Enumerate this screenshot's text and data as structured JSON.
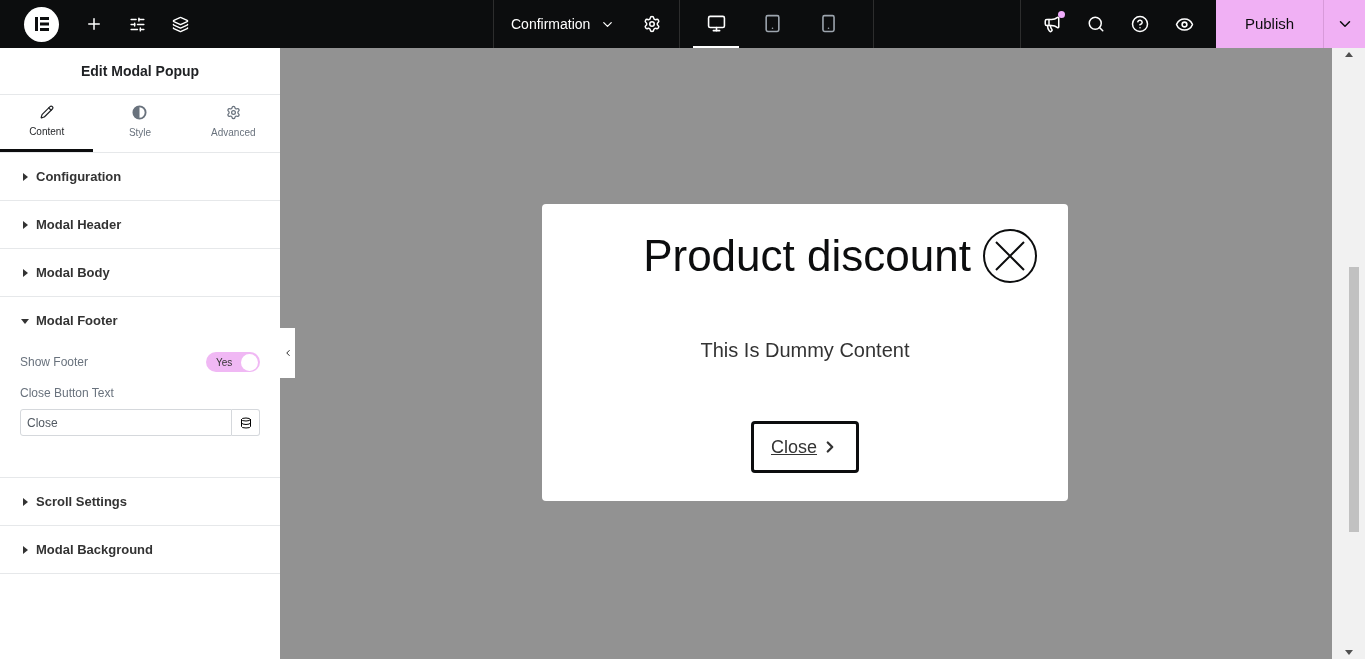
{
  "topbar": {
    "document_title": "Confirmation",
    "devices": [
      {
        "kind": "desktop",
        "selected": true
      },
      {
        "kind": "tablet",
        "selected": false
      },
      {
        "kind": "mobile",
        "selected": false
      }
    ],
    "notification": true,
    "publish": "Publish"
  },
  "panel": {
    "title": "Edit Modal Popup",
    "tabs": [
      {
        "kind": "content",
        "label": "Content",
        "selected": true
      },
      {
        "kind": "style",
        "label": "Style",
        "selected": false
      },
      {
        "kind": "advanced",
        "label": "Advanced",
        "selected": false
      }
    ],
    "sections": [
      {
        "title": "Configuration",
        "expanded": false
      },
      {
        "title": "Modal Header",
        "expanded": false
      },
      {
        "title": "Modal Body",
        "expanded": false
      },
      {
        "title": "Modal Footer",
        "expanded": true,
        "controls": [
          {
            "kind": "toggle",
            "label": "Show Footer",
            "on": true,
            "toggle_label": "Yes"
          },
          {
            "kind": "text",
            "label": "Close Button Text",
            "value": "Close"
          }
        ]
      },
      {
        "title": "Scroll Settings",
        "expanded": false
      },
      {
        "title": "Modal Background",
        "expanded": false
      }
    ]
  },
  "modal": {
    "title": "Product discount",
    "body": "This Is Dummy Content",
    "button": "Close"
  }
}
